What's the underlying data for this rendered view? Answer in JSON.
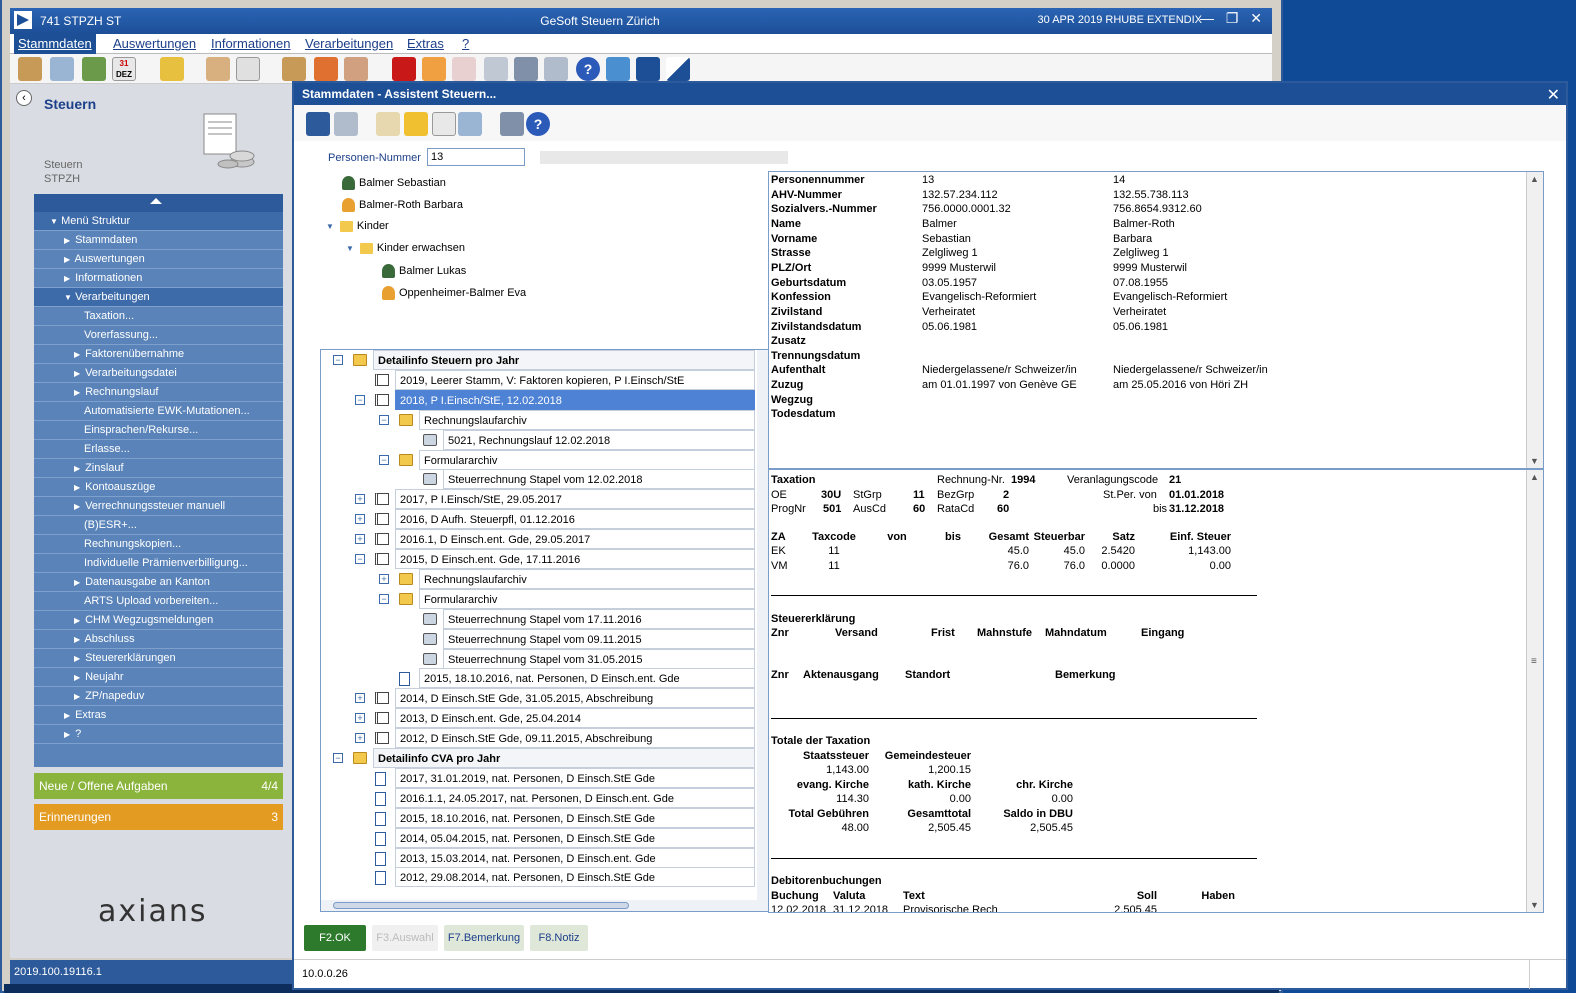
{
  "window": {
    "app": "741  STPZH  ST",
    "title": "GeSoft Steuern Zürich",
    "right": "30 APR 2019  RHUBE  EXTENDIX"
  },
  "menu": [
    "Stammdaten",
    "Auswertungen",
    "Informationen",
    "Verarbeitungen",
    "Extras",
    "?"
  ],
  "left": {
    "title": "Steuern",
    "sub1": "Steuern",
    "sub2": "STPZH",
    "nav": [
      {
        "label": "Menü Struktur",
        "indent": 1,
        "arrow": "▼",
        "hdr": true
      },
      {
        "label": "Stammdaten",
        "indent": 2,
        "arrow": "▶"
      },
      {
        "label": "Auswertungen",
        "indent": 2,
        "arrow": "▶"
      },
      {
        "label": "Informationen",
        "indent": 2,
        "arrow": "▶"
      },
      {
        "label": "Verarbeitungen",
        "indent": 2,
        "arrow": "▼",
        "hdr": true
      },
      {
        "label": "Taxation...",
        "indent": 3,
        "arrow": ""
      },
      {
        "label": "Vorerfassung...",
        "indent": 3,
        "arrow": ""
      },
      {
        "label": "Faktorenübernahme",
        "indent": 3,
        "arrow": "▶"
      },
      {
        "label": "Verarbeitungsdatei",
        "indent": 3,
        "arrow": "▶"
      },
      {
        "label": "Rechnungslauf",
        "indent": 3,
        "arrow": "▶"
      },
      {
        "label": "Automatisierte EWK-Mutationen...",
        "indent": 3,
        "arrow": ""
      },
      {
        "label": "Einsprachen/Rekurse...",
        "indent": 3,
        "arrow": ""
      },
      {
        "label": "Erlasse...",
        "indent": 3,
        "arrow": ""
      },
      {
        "label": "Zinslauf",
        "indent": 3,
        "arrow": "▶"
      },
      {
        "label": "Kontoauszüge",
        "indent": 3,
        "arrow": "▶"
      },
      {
        "label": "Verrechnungssteuer manuell",
        "indent": 3,
        "arrow": "▶"
      },
      {
        "label": "(B)ESR+...",
        "indent": 3,
        "arrow": ""
      },
      {
        "label": "Rechnungskopien...",
        "indent": 3,
        "arrow": ""
      },
      {
        "label": "Individuelle Prämienverbilligung...",
        "indent": 3,
        "arrow": ""
      },
      {
        "label": "Datenausgabe an Kanton",
        "indent": 3,
        "arrow": "▶"
      },
      {
        "label": "ARTS Upload vorbereiten...",
        "indent": 3,
        "arrow": ""
      },
      {
        "label": "CHM Wegzugsmeldungen",
        "indent": 3,
        "arrow": "▶"
      },
      {
        "label": "Abschluss",
        "indent": 3,
        "arrow": "▶"
      },
      {
        "label": "Steuererklärungen",
        "indent": 3,
        "arrow": "▶"
      },
      {
        "label": "Neujahr",
        "indent": 3,
        "arrow": "▶"
      },
      {
        "label": "ZP/napeduv",
        "indent": 3,
        "arrow": "▶"
      },
      {
        "label": "Extras",
        "indent": 2,
        "arrow": "▶"
      },
      {
        "label": "?",
        "indent": 2,
        "arrow": "▶"
      }
    ],
    "tasks": {
      "label": "Neue / Offene Aufgaben",
      "count": "4/4"
    },
    "reminders": {
      "label": "Erinnerungen",
      "count": "3"
    },
    "logo": "axians",
    "version": "2019.100.19116.1"
  },
  "dialog": {
    "title": "Stammdaten - Assistent Steuern...",
    "pn_label": "Personen-Nummer",
    "pn_value": "13",
    "persons": [
      "Balmer Sebastian",
      "Balmer-Roth Barbara",
      "Kinder",
      "Kinder erwachsen",
      "Balmer Lukas",
      "Oppenheimer-Balmer Eva"
    ],
    "tree": [
      {
        "t": "Detailinfo Steuern pro Jahr",
        "lv": 0,
        "ic": "fold",
        "tg": "−",
        "grp": true
      },
      {
        "t": "2019, Leerer Stamm, V: Faktoren kopieren, P I.Einsch/StE",
        "lv": 1,
        "ic": "book",
        "tg": ""
      },
      {
        "t": "2018, P I.Einsch/StE, 12.02.2018",
        "lv": 1,
        "ic": "book",
        "tg": "−",
        "sel": true
      },
      {
        "t": "Rechnungslaufarchiv",
        "lv": 2,
        "ic": "fold",
        "tg": "−"
      },
      {
        "t": "5021, Rechnungslauf  12.02.2018",
        "lv": 3,
        "ic": "prn",
        "tg": ""
      },
      {
        "t": "Formulararchiv",
        "lv": 2,
        "ic": "fold",
        "tg": "−"
      },
      {
        "t": "Steuerrechnung Stapel vom 12.02.2018",
        "lv": 3,
        "ic": "prn",
        "tg": ""
      },
      {
        "t": "2017, P I.Einsch/StE, 29.05.2017",
        "lv": 1,
        "ic": "book",
        "tg": "+"
      },
      {
        "t": "2016, D Aufh. Steuerpfl, 01.12.2016",
        "lv": 1,
        "ic": "book",
        "tg": "+"
      },
      {
        "t": "2016.1, D Einsch.ent. Gde, 29.05.2017",
        "lv": 1,
        "ic": "book",
        "tg": "+"
      },
      {
        "t": "2015, D Einsch.ent. Gde, 17.11.2016",
        "lv": 1,
        "ic": "book",
        "tg": "−"
      },
      {
        "t": "Rechnungslaufarchiv",
        "lv": 2,
        "ic": "fold",
        "tg": "+"
      },
      {
        "t": "Formulararchiv",
        "lv": 2,
        "ic": "fold",
        "tg": "−"
      },
      {
        "t": "Steuerrechnung Stapel vom 17.11.2016",
        "lv": 3,
        "ic": "prn",
        "tg": ""
      },
      {
        "t": "Steuerrechnung Stapel vom 09.11.2015",
        "lv": 3,
        "ic": "prn",
        "tg": ""
      },
      {
        "t": "Steuerrechnung Stapel vom 31.05.2015",
        "lv": 3,
        "ic": "prn",
        "tg": ""
      },
      {
        "t": "2015, 18.10.2016, nat. Personen, D Einsch.ent. Gde",
        "lv": 2,
        "ic": "doc",
        "tg": ""
      },
      {
        "t": "2014, D Einsch.StE Gde, 31.05.2015, Abschreibung",
        "lv": 1,
        "ic": "book",
        "tg": "+"
      },
      {
        "t": "2013, D Einsch.ent. Gde, 25.04.2014",
        "lv": 1,
        "ic": "book",
        "tg": "+"
      },
      {
        "t": "2012, D Einsch.StE Gde, 09.11.2015, Abschreibung",
        "lv": 1,
        "ic": "book",
        "tg": "+"
      },
      {
        "t": "Detailinfo CVA pro Jahr",
        "lv": 0,
        "ic": "fold",
        "tg": "−",
        "grp": true
      },
      {
        "t": "2017, 31.01.2019, nat. Personen, D Einsch.StE Gde",
        "lv": 1,
        "ic": "doc",
        "tg": ""
      },
      {
        "t": "2016.1.1, 24.05.2017, nat. Personen, D Einsch.ent. Gde",
        "lv": 1,
        "ic": "doc",
        "tg": ""
      },
      {
        "t": "2015, 18.10.2016, nat. Personen, D Einsch.StE Gde",
        "lv": 1,
        "ic": "doc",
        "tg": ""
      },
      {
        "t": "2014, 05.04.2015, nat. Personen, D Einsch.StE Gde",
        "lv": 1,
        "ic": "doc",
        "tg": ""
      },
      {
        "t": "2013, 15.03.2014, nat. Personen, D Einsch.ent. Gde",
        "lv": 1,
        "ic": "doc",
        "tg": ""
      },
      {
        "t": "2012, 29.08.2014, nat. Personen, D Einsch.StE Gde",
        "lv": 1,
        "ic": "doc",
        "tg": ""
      }
    ],
    "info": [
      [
        "Personennummer",
        "13",
        "14"
      ],
      [
        "AHV-Nummer",
        "132.57.234.112",
        "132.55.738.113"
      ],
      [
        "Sozialvers.-Nummer",
        "756.0000.0001.32",
        "756.8654.9312.60"
      ],
      [
        "Name",
        "Balmer",
        "Balmer-Roth"
      ],
      [
        "Vorname",
        "Sebastian",
        "Barbara"
      ],
      [
        "Strasse",
        "Zelgliweg 1",
        "Zelgliweg 1"
      ],
      [
        "PLZ/Ort",
        "9999 Musterwil",
        "9999 Musterwil"
      ],
      [
        "Geburtsdatum",
        "03.05.1957",
        "07.08.1955"
      ],
      [
        "Konfession",
        "Evangelisch-Reformiert",
        "Evangelisch-Reformiert"
      ],
      [
        "Zivilstand",
        "Verheiratet",
        "Verheiratet"
      ],
      [
        "Zivilstandsdatum",
        "05.06.1981",
        "05.06.1981"
      ],
      [
        "Zusatz",
        "",
        ""
      ],
      [
        "Trennungsdatum",
        "",
        ""
      ],
      [
        "Aufenthalt",
        "Niedergelassene/r Schweizer/in",
        "Niedergelassene/r Schweizer/in"
      ],
      [
        "Zuzug",
        "am 01.01.1997 von Genève GE",
        "am 25.05.2016 von Höri ZH"
      ],
      [
        "Wegzug",
        "",
        ""
      ],
      [
        "Todesdatum",
        "",
        ""
      ]
    ],
    "tax": {
      "taxation": "Taxation",
      "rnr_l": "Rechnung-Nr.",
      "rnr": "1994",
      "vc_l": "Veranlagungscode",
      "vc": "21",
      "oe_l": "OE",
      "oe": "30U",
      "stgrp_l": "StGrp",
      "stgrp": "11",
      "bezgrp_l": "BezGrp",
      "bezgrp": "2",
      "stpervon_l": "St.Per. von",
      "stpervon": "01.01.2018",
      "prognr_l": "ProgNr",
      "prognr": "501",
      "auscd_l": "AusCd",
      "auscd": "60",
      "ratacd_l": "RataCd",
      "ratacd": "60",
      "bis_l": "bis",
      "bis": "31.12.2018",
      "cols": [
        "ZA",
        "Taxcode",
        "von",
        "bis",
        "Gesamt",
        "Steuerbar",
        "Satz",
        "Einf. Steuer"
      ],
      "rows": [
        [
          "EK",
          "11",
          "",
          "",
          "45.0",
          "45.0",
          "2.5420",
          "1,143.00"
        ],
        [
          "VM",
          "11",
          "",
          "",
          "76.0",
          "76.0",
          "0.0000",
          "0.00"
        ]
      ],
      "se": "Steuererklärung",
      "se_cols": [
        "Znr",
        "Versand",
        "Frist",
        "Mahnstufe",
        "Mahndatum",
        "Eingang"
      ],
      "ak_cols": [
        "Znr",
        "Aktenausgang",
        "Standort",
        "Bemerkung"
      ],
      "tot": "Totale der Taxation",
      "staat_l": "Staatssteuer",
      "staat": "1,143.00",
      "gem_l": "Gemeindesteuer",
      "gem": "1,200.15",
      "evk_l": "evang. Kirche",
      "evk": "114.30",
      "kk_l": "kath. Kirche",
      "kk": "0.00",
      "chr_l": "chr. Kirche",
      "chr": "0.00",
      "geb_l": "Total Gebühren",
      "geb": "48.00",
      "ges_l": "Gesamttotal",
      "ges": "2,505.45",
      "sal_l": "Saldo in DBU",
      "sal": "2,505.45",
      "deb": "Debitorenbuchungen",
      "deb_cols": [
        "Buchung",
        "Valuta",
        "Text",
        "Soll",
        "Haben"
      ],
      "deb_row": [
        "12.02.2018",
        "31.12.2018",
        "Provisorische Rech",
        "2,505.45",
        ""
      ]
    },
    "buttons": [
      "F2.OK",
      "F3.Auswahl",
      "F7.Bemerkung",
      "F8.Notiz"
    ],
    "ip": "10.0.0.26"
  }
}
